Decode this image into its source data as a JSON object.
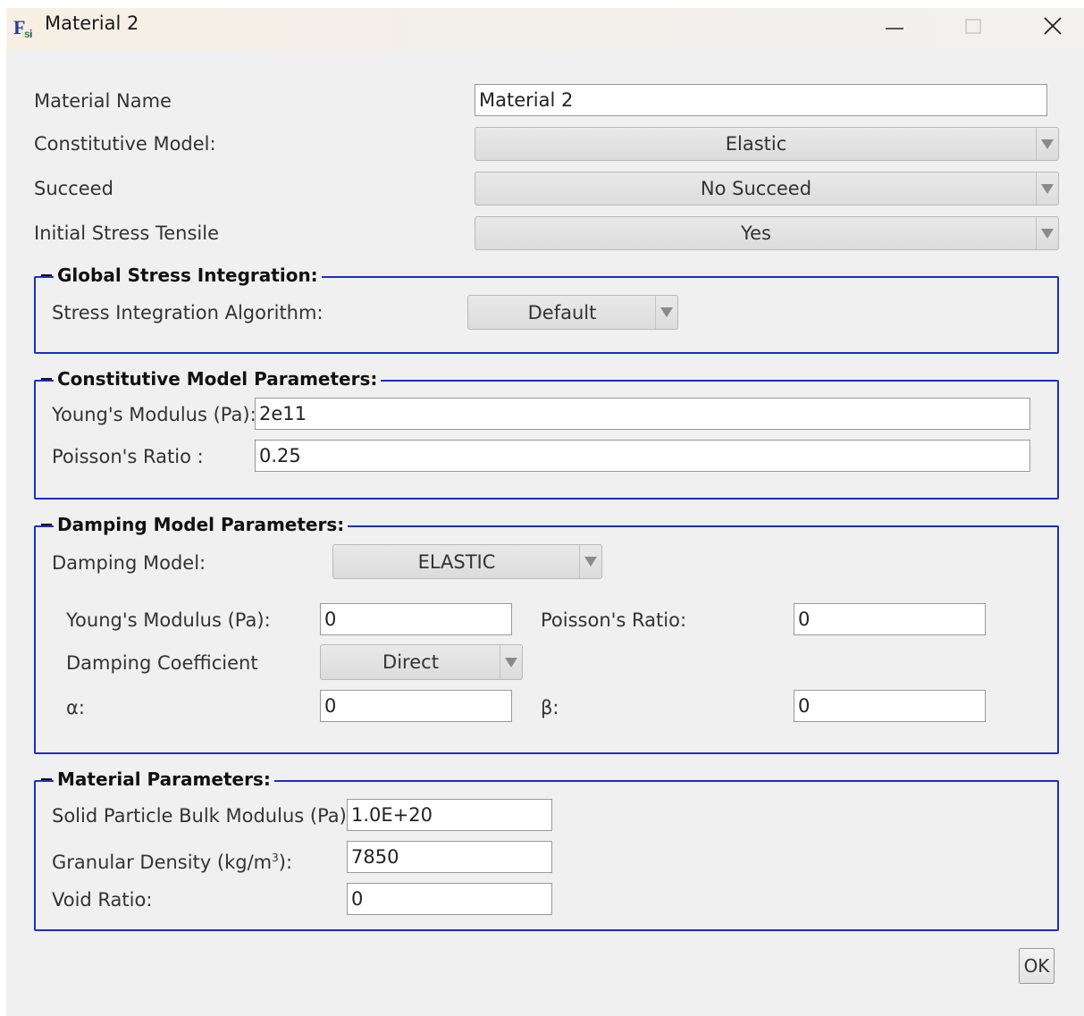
{
  "window": {
    "title": "Material 2"
  },
  "general": {
    "material_name_label": "Material Name",
    "material_name_value": "Material 2",
    "constitutive_model_label": "Constitutive Model:",
    "constitutive_model_value": "Elastic",
    "succeed_label": "Succeed",
    "succeed_value": "No Succeed",
    "initial_stress_label": "Initial Stress Tensile",
    "initial_stress_value": "Yes"
  },
  "global_stress": {
    "title": "Global Stress Integration:",
    "algorithm_label": "Stress Integration Algorithm:",
    "algorithm_value": "Default"
  },
  "constitutive_params": {
    "title": "Constitutive Model Parameters:",
    "youngs_label": "Young's Modulus (Pa):",
    "youngs_value": "2e11",
    "poisson_label": "Poisson's Ratio :",
    "poisson_value": "0.25"
  },
  "damping": {
    "title": "Damping Model Parameters:",
    "model_label": "Damping Model:",
    "model_value": "ELASTIC",
    "youngs_label": "Young's Modulus (Pa):",
    "youngs_value": "0",
    "poisson_label": "Poisson's Ratio:",
    "poisson_value": "0",
    "coefficient_label": "Damping Coefficient",
    "coefficient_value": "Direct",
    "alpha_label": "α:",
    "alpha_value": "0",
    "beta_label": "β:",
    "beta_value": "0"
  },
  "material_params": {
    "title": "Material Parameters:",
    "bulk_modulus_label": "Solid Particle Bulk Modulus (Pa):",
    "bulk_modulus_value": "1.0E+20",
    "density_label_prefix": "Granular Density (kg/m",
    "density_label_sup": "3",
    "density_label_suffix": "):",
    "density_value": "7850",
    "void_ratio_label": "Void Ratio:",
    "void_ratio_value": "0"
  },
  "buttons": {
    "ok": "OK"
  },
  "colors": {
    "group_border": "#1a2ec8",
    "window_bg": "#f0f0f0"
  },
  "icons": [
    "app-logo-icon",
    "minimize-icon",
    "maximize-icon",
    "close-icon",
    "dropdown-arrow-icon"
  ]
}
